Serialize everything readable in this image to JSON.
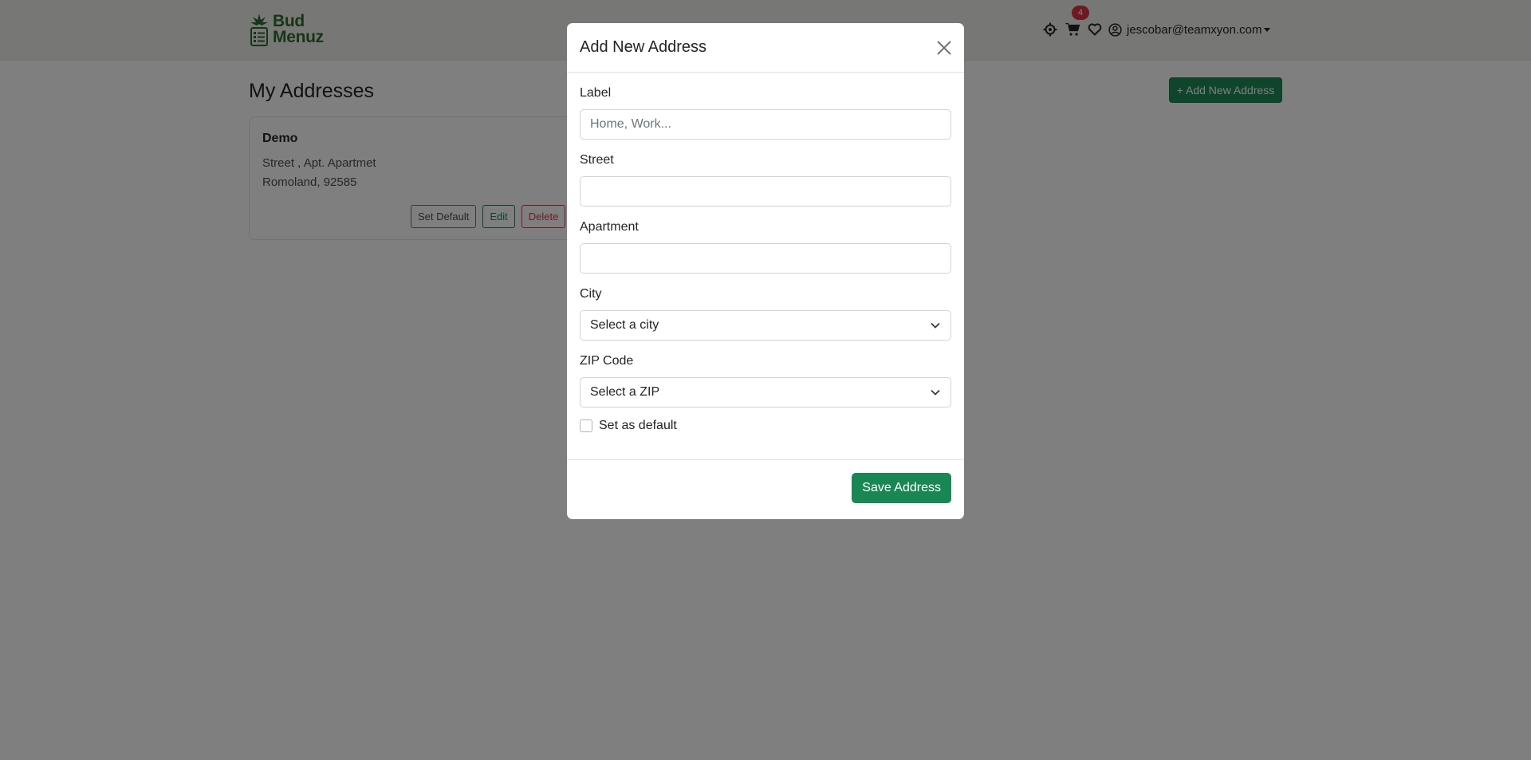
{
  "brand": {
    "line1": "Bud",
    "line2": "Menuz",
    "color": "#2e6b2f"
  },
  "nav": {
    "icons": [
      "location-target-icon",
      "cart-icon",
      "heart-icon",
      "user-circle-icon"
    ],
    "cart_count": "4",
    "user_email": "jescobar@teamxyon.com"
  },
  "page": {
    "title": "My Addresses",
    "add_button": "+ Add New Address"
  },
  "addresses": [
    {
      "label": "Demo",
      "line1": "Street , Apt. Apartmet",
      "line2": "Romoland, 92585",
      "actions": {
        "set_default": "Set Default",
        "edit": "Edit",
        "delete": "Delete"
      }
    }
  ],
  "modal": {
    "title": "Add New Address",
    "fields": {
      "label": {
        "label": "Label",
        "placeholder": "Home, Work...",
        "value": ""
      },
      "street": {
        "label": "Street",
        "value": ""
      },
      "apartment": {
        "label": "Apartment",
        "value": ""
      },
      "city": {
        "label": "City",
        "selected": "Select a city"
      },
      "zip": {
        "label": "ZIP Code",
        "selected": "Select a ZIP"
      }
    },
    "default_checkbox": {
      "label": "Set as default",
      "checked": false
    },
    "save_button": "Save Address"
  },
  "colors": {
    "primary_green": "#198754",
    "danger": "#dc3545",
    "navbar_bg": "#eef1ea"
  }
}
